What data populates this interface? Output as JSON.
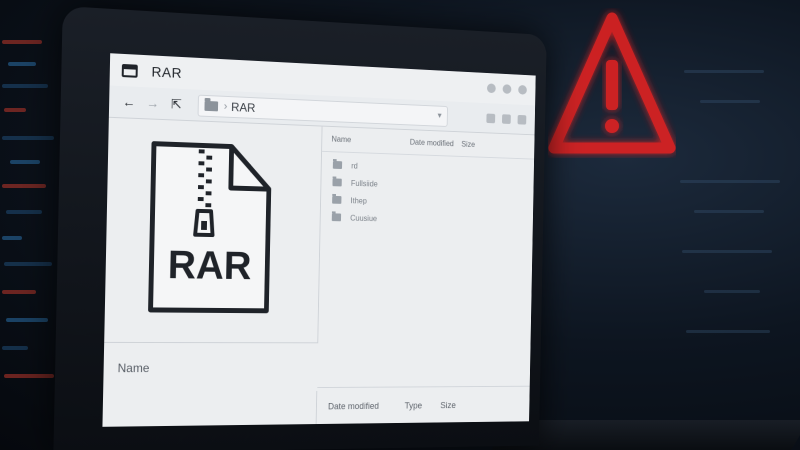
{
  "window": {
    "title": "RAR"
  },
  "address_bar": {
    "path": "RAR"
  },
  "preview": {
    "file_label": "RAR",
    "name_label": "Name"
  },
  "list": {
    "columns": [
      "Name",
      "Date modified",
      "Size"
    ],
    "rows": [
      {
        "label": "rd"
      },
      {
        "label": "Fullsiide"
      },
      {
        "label": "Ithep"
      },
      {
        "label": "Cuusiue"
      }
    ],
    "footer": {
      "date_modified": "Date modified",
      "type": "Type",
      "size": "Size"
    }
  },
  "icons": {
    "back": "arrow-left-icon",
    "forward": "arrow-right-icon",
    "up": "folder-up-icon",
    "folder": "folder-icon",
    "warning": "warning-triangle-icon",
    "archive": "zip-file-icon"
  },
  "colors": {
    "warning": "#e02424",
    "screen_bg": "#e9ecef",
    "icon_stroke": "#1f2329"
  }
}
